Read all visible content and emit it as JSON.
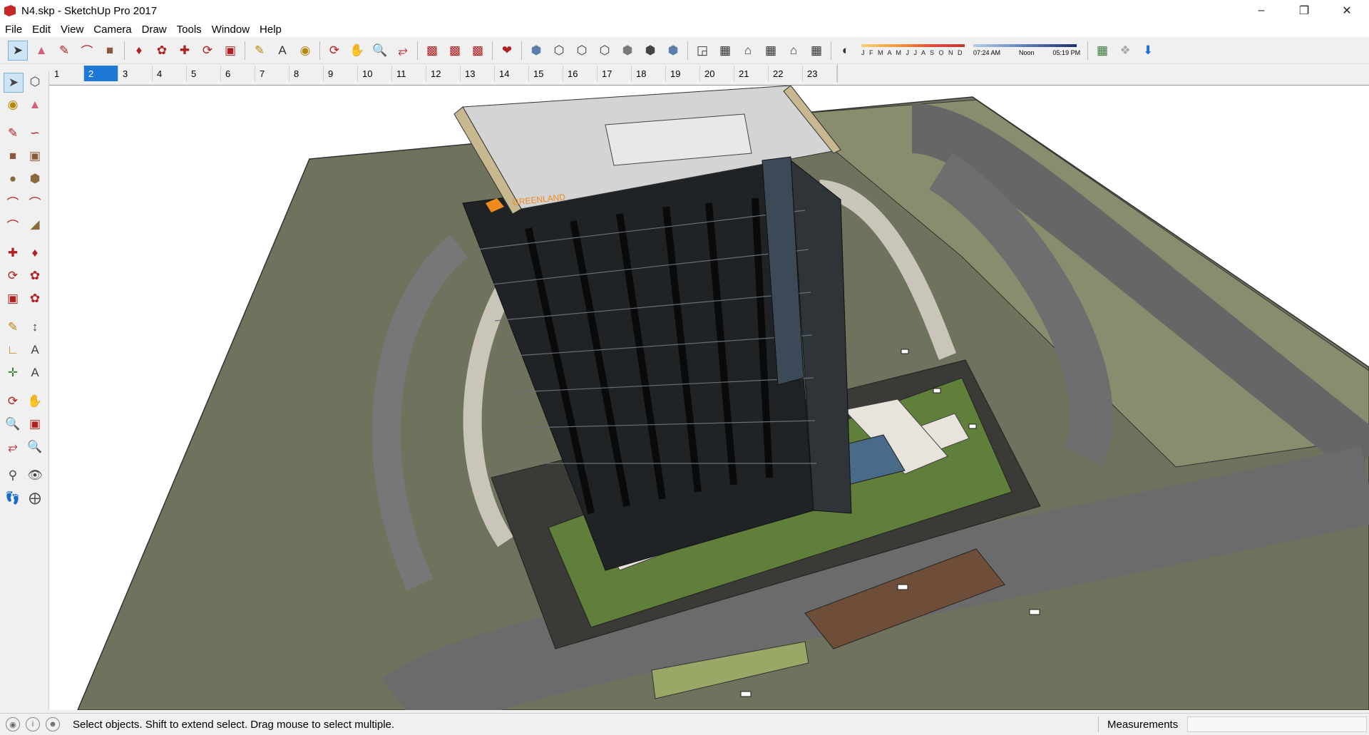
{
  "window": {
    "title": "N4.skp - SketchUp Pro 2017",
    "minimize_icon": "minimize-icon",
    "maximize_icon": "restore-icon",
    "close_icon": "close-icon"
  },
  "menu": [
    "File",
    "Edit",
    "View",
    "Camera",
    "Draw",
    "Tools",
    "Window",
    "Help"
  ],
  "shadow_settings": {
    "months": "J F M A M J J A S O N D",
    "sunrise": "07:24 AM",
    "noon": "Noon",
    "sunset": "05:19 PM"
  },
  "scenes": {
    "tabs": [
      "1",
      "2",
      "3",
      "4",
      "5",
      "6",
      "7",
      "8",
      "9",
      "10",
      "11",
      "12",
      "13",
      "14",
      "15",
      "16",
      "17",
      "18",
      "19",
      "20",
      "21",
      "22",
      "23"
    ],
    "active": "2"
  },
  "model": {
    "sign_text": "GREENLAND"
  },
  "status": {
    "hint": "Select objects. Shift to extend select. Drag mouse to select multiple.",
    "measurements_label": "Measurements",
    "measurements_value": ""
  }
}
